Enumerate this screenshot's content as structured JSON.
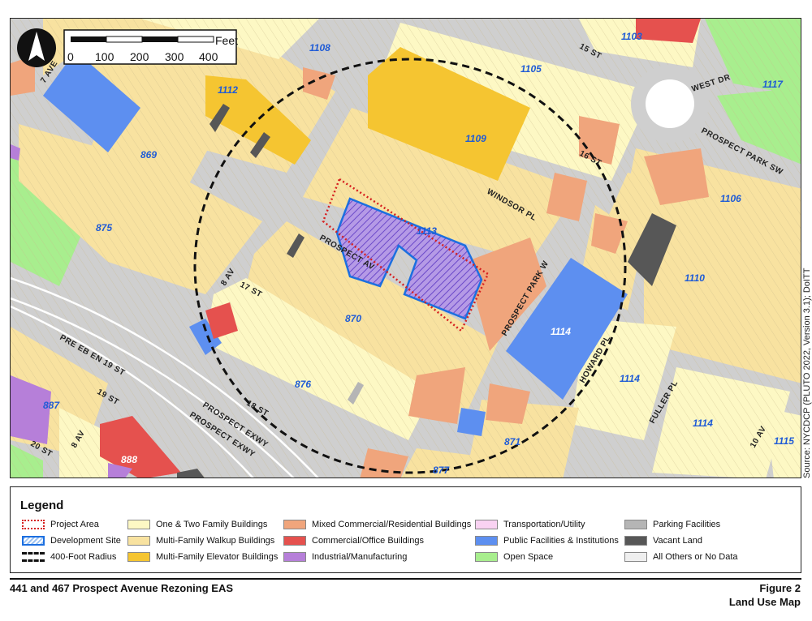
{
  "map": {
    "north_arrow": "north-arrow-icon",
    "scale_bar": {
      "unit": "Feet",
      "ticks": [
        "0",
        "100",
        "200",
        "300",
        "400"
      ]
    },
    "block_labels": [
      "1108",
      "1103",
      "1105",
      "1117",
      "1112",
      "1109",
      "869",
      "1106",
      "875",
      "1113",
      "1110",
      "870",
      "1114",
      "1114",
      "1114",
      "876",
      "887",
      "888",
      "871",
      "877",
      "1115"
    ],
    "street_labels": [
      "7 AVE",
      "15 ST",
      "WEST DR",
      "16 ST",
      "PROSPECT PARK SW",
      "WINDSOR PL",
      "PROSPECT AV",
      "8 AV",
      "17 ST",
      "PROSPECT PARK W",
      "HOWARD PL",
      "FULLER PL",
      "10 AV",
      "PRE EB EN 19 ST",
      "19 ST",
      "18 ST",
      "PROSPECT EXWY",
      "PROSPECT EXWY",
      "8 AV",
      "20 ST"
    ],
    "source_note": "Source: NYCDCP (PLUTO 2022, Version 3.1); DoITT"
  },
  "legend": {
    "title": "Legend",
    "items": [
      {
        "label": "Project Area",
        "swatch": "project"
      },
      {
        "label": "Development Site",
        "swatch": "dev"
      },
      {
        "label": "400-Foot Radius",
        "swatch": "radius"
      },
      {
        "label": "One & Two Family Buildings",
        "color": "#fdf8c4"
      },
      {
        "label": "Multi-Family Walkup Buildings",
        "color": "#f8e2a0"
      },
      {
        "label": "Multi-Family Elevator Buildings",
        "color": "#f5c531"
      },
      {
        "label": "Mixed Commercial/Residential Buildings",
        "color": "#f0a57c"
      },
      {
        "label": "Commercial/Office Buildings",
        "color": "#e5514e"
      },
      {
        "label": "Industrial/Manufacturing",
        "color": "#b67fd9"
      },
      {
        "label": "Transportation/Utility",
        "color": "#f9d2f2"
      },
      {
        "label": "Public Facilities & Institutions",
        "color": "#5d8ff0"
      },
      {
        "label": "Open Space",
        "color": "#a8ee8e"
      },
      {
        "label": "Parking Facilities",
        "color": "#b5b5b5"
      },
      {
        "label": "Vacant Land",
        "color": "#575757"
      },
      {
        "label": "All Others or No Data",
        "color": "#efefef"
      }
    ]
  },
  "footer": {
    "project_title": "441 and 467 Prospect Avenue Rezoning EAS",
    "figure_number": "Figure 2",
    "figure_title": "Land Use Map"
  }
}
